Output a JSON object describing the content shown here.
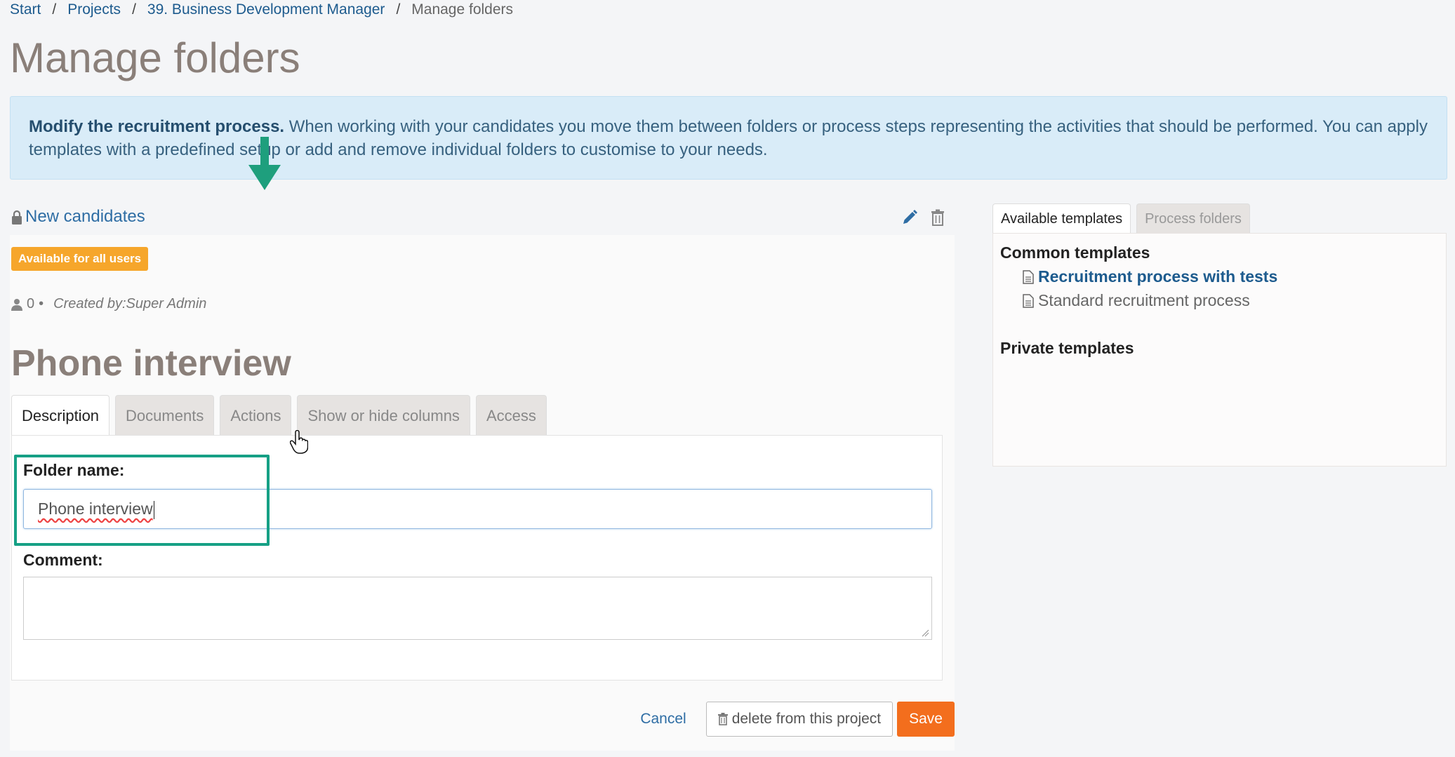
{
  "breadcrumb": {
    "items": [
      "Start",
      "Projects",
      "39. Business Development Manager"
    ],
    "current": "Manage folders",
    "separator": "/"
  },
  "page": {
    "title": "Manage folders"
  },
  "info": {
    "lead": "Modify the recruitment process.",
    "body": " When working with your candidates you move them between folders or process steps representing the activities that should be performed. You can apply templates with a predefined setup or add and remove individual folders to customise to your needs."
  },
  "folder": {
    "title": "New candidates",
    "badge": "Available for all users",
    "count": "0",
    "bullet": "•",
    "created_by": "Created by:Super Admin"
  },
  "subfolder": {
    "title": "Phone interview"
  },
  "tabs": [
    {
      "label": "Description",
      "active": true
    },
    {
      "label": "Documents",
      "active": false
    },
    {
      "label": "Actions",
      "active": false
    },
    {
      "label": "Show or hide columns",
      "active": false
    },
    {
      "label": "Access",
      "active": false
    }
  ],
  "form": {
    "folder_name_label": "Folder name:",
    "folder_name_value": "Phone interview",
    "comment_label": "Comment:",
    "comment_value": ""
  },
  "actions": {
    "cancel": "Cancel",
    "delete": "delete from this project",
    "save": "Save"
  },
  "right": {
    "tabs": [
      {
        "label": "Available templates",
        "active": true
      },
      {
        "label": "Process folders",
        "active": false
      }
    ],
    "common_heading": "Common templates",
    "common_items": [
      "Recruitment process with tests",
      "Standard recruitment process"
    ],
    "private_heading": "Private templates"
  },
  "colors": {
    "accent_green": "#16a085",
    "badge_orange": "#f6a62b",
    "save_orange": "#f36e1d",
    "link_blue": "#1d5b8e",
    "info_bg": "#d9ecf8"
  }
}
